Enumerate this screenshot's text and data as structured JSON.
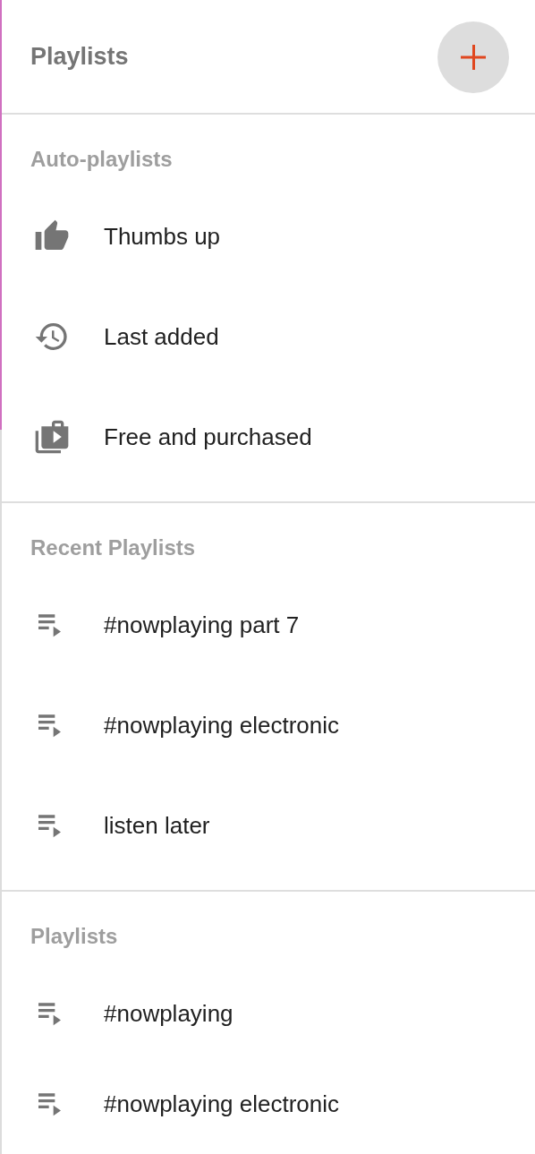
{
  "header": {
    "title": "Playlists"
  },
  "sections": [
    {
      "heading": "Auto-playlists",
      "items": [
        {
          "label": "Thumbs up",
          "kind": "thumbs"
        },
        {
          "label": "Last added",
          "kind": "history"
        },
        {
          "label": "Free and purchased",
          "kind": "purchased"
        }
      ]
    },
    {
      "heading": "Recent Playlists",
      "items": [
        {
          "label": "#nowplaying part 7",
          "kind": "playlist"
        },
        {
          "label": "#nowplaying electronic",
          "kind": "playlist"
        },
        {
          "label": "listen later",
          "kind": "playlist"
        }
      ]
    },
    {
      "heading": "Playlists",
      "items": [
        {
          "label": "#nowplaying",
          "kind": "playlist"
        },
        {
          "label": "#nowplaying electronic",
          "kind": "playlist"
        }
      ]
    }
  ]
}
